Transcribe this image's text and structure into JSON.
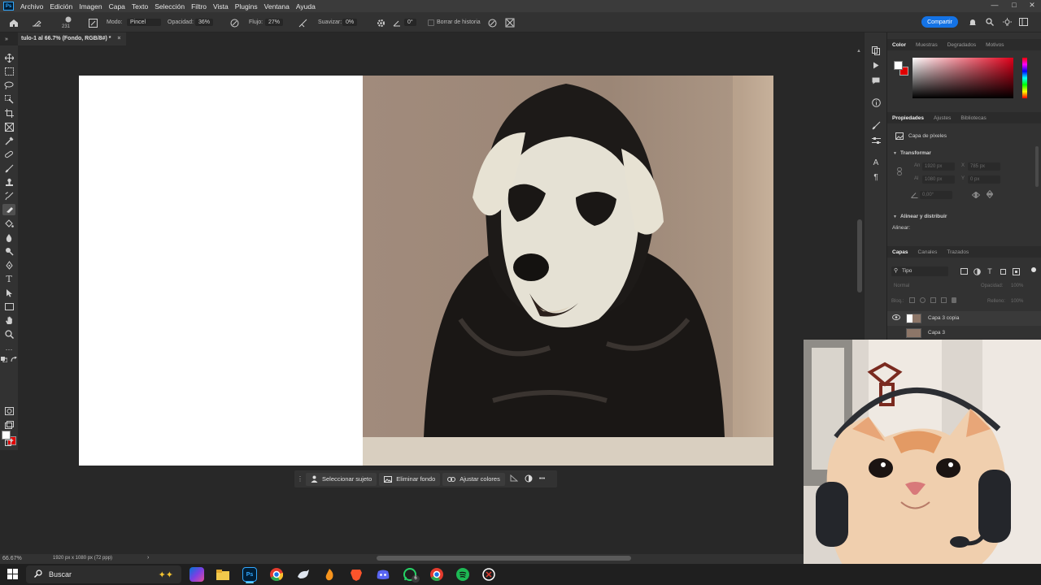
{
  "app": {
    "logo": "Ps",
    "menu": [
      "Archivo",
      "Edición",
      "Imagen",
      "Capa",
      "Texto",
      "Selección",
      "Filtro",
      "Vista",
      "Plugins",
      "Ventana",
      "Ayuda"
    ]
  },
  "options_bar": {
    "brush_size": "231",
    "mode_label": "Modo:",
    "mode_value": "Pincel",
    "opacity_label": "Opacidad:",
    "opacity_value": "36%",
    "flow_label": "Flujo:",
    "flow_value": "27%",
    "smoothing_label": "Suavizar:",
    "smoothing_value": "0%",
    "angle_value": "0°",
    "erase_history_label": "Borrar de historia",
    "share_label": "Compartir"
  },
  "document": {
    "tab_title": "tulo-1 al 66.7% (Fondo, RGB/8#) *",
    "close_glyph": "×"
  },
  "context_bar": {
    "select_subject": "Seleccionar sujeto",
    "remove_bg": "Eliminar fondo",
    "adjust_colors": "Ajustar colores",
    "more": "•••"
  },
  "status_bar": {
    "zoom": "66.67%",
    "doc_info": "1920 px x 1080 px (72 ppp)",
    "arrow": "›"
  },
  "color_panel": {
    "tabs": [
      "Color",
      "Muestras",
      "Degradados",
      "Motivos"
    ],
    "foreground": "#ffffff",
    "background": "#e00000"
  },
  "properties_panel": {
    "tabs": [
      "Propiedades",
      "Ajustes",
      "Bibliotecas"
    ],
    "layer_type": "Capa de píxeles",
    "transform_title": "Transformar",
    "w_label": "An",
    "w_value": "1920 px",
    "x_label": "X",
    "x_value": "785 px",
    "h_label": "Al",
    "h_value": "1080 px",
    "y_label": "Y",
    "y_value": "0 px",
    "angle_value": "0,00°",
    "align_title": "Alinear y distribuir",
    "align_label": "Alinear:"
  },
  "layers_panel": {
    "tabs": [
      "Capas",
      "Canales",
      "Trazados"
    ],
    "filter_label": "Tipo",
    "blend_mode": "Normal",
    "opacity_label": "Opacidad:",
    "opacity_value": "100%",
    "lock_label": "Bloq.:",
    "fill_label": "Relleno:",
    "fill_value": "100%",
    "layers": [
      {
        "name": "Capa 3 copia"
      },
      {
        "name": "Capa 3"
      }
    ]
  },
  "taskbar": {
    "search_placeholder": "Buscar",
    "whatsapp_badge": "6"
  }
}
